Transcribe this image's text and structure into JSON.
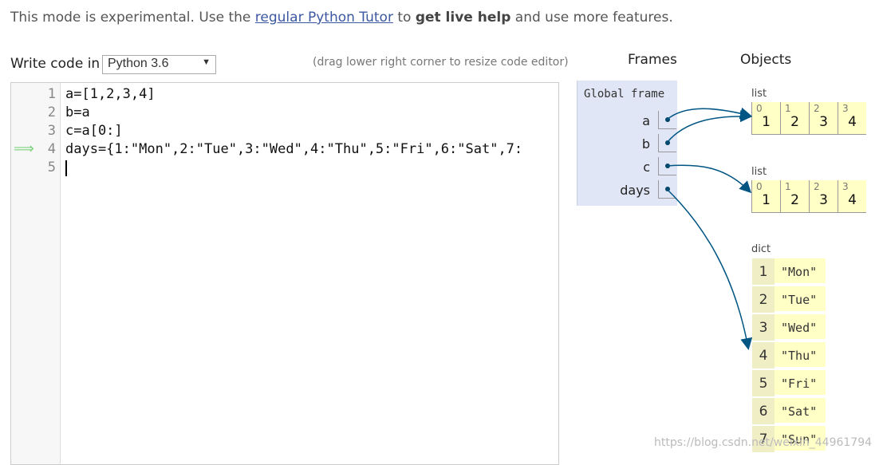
{
  "notice": {
    "prefix": "This mode is experimental. Use the ",
    "link": "regular Python Tutor",
    "middle": " to ",
    "bold": "get live help",
    "suffix": " and use more features."
  },
  "editor": {
    "write_label": "Write code in",
    "language": "Python 3.6",
    "drag_hint": "(drag lower right corner to resize code editor)",
    "lines": [
      {
        "no": "1",
        "text": "a=[1,2,3,4]"
      },
      {
        "no": "2",
        "text": "b=a"
      },
      {
        "no": "3",
        "text": "c=a[0:]"
      },
      {
        "no": "4",
        "text": "days={1:\"Mon\",2:\"Tue\",3:\"Wed\",4:\"Thu\",5:\"Fri\",6:\"Sat\",7:"
      },
      {
        "no": "5",
        "text": ""
      }
    ],
    "current_line_marker": "⟹"
  },
  "headers": {
    "frames": "Frames",
    "objects": "Objects"
  },
  "frame": {
    "title": "Global frame",
    "vars": [
      "a",
      "b",
      "c",
      "days"
    ]
  },
  "objects": {
    "list1": {
      "type": "list",
      "indices": [
        "0",
        "1",
        "2",
        "3"
      ],
      "values": [
        "1",
        "2",
        "3",
        "4"
      ]
    },
    "list2": {
      "type": "list",
      "indices": [
        "0",
        "1",
        "2",
        "3"
      ],
      "values": [
        "1",
        "2",
        "3",
        "4"
      ]
    },
    "dict": {
      "type": "dict",
      "entries": [
        {
          "key": "1",
          "value": "\"Mon\""
        },
        {
          "key": "2",
          "value": "\"Tue\""
        },
        {
          "key": "3",
          "value": "\"Wed\""
        },
        {
          "key": "4",
          "value": "\"Thu\""
        },
        {
          "key": "5",
          "value": "\"Fri\""
        },
        {
          "key": "6",
          "value": "\"Sat\""
        },
        {
          "key": "7",
          "value": "\"Sun\""
        }
      ]
    }
  },
  "watermark": "https://blog.csdn.net/weixin_44961794",
  "colors": {
    "frame_bg": "#e0e6f5",
    "heap_bg": "#ffffc6",
    "pointer": "#005583",
    "link": "#3d58a2"
  }
}
